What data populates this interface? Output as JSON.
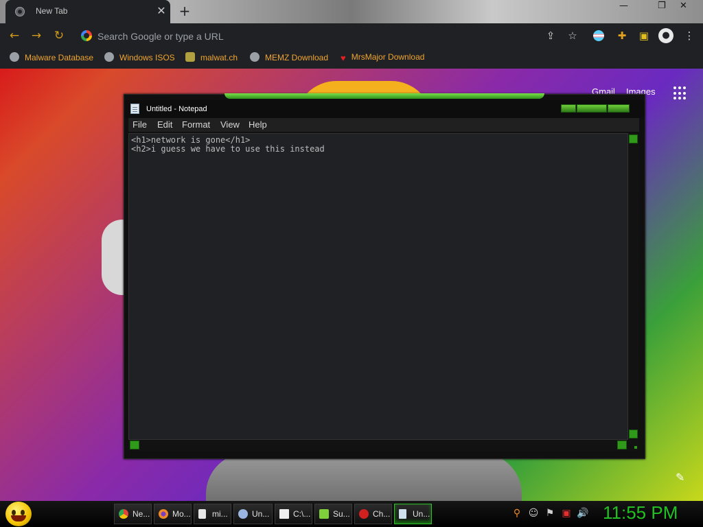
{
  "browser": {
    "tab_title": "New Tab",
    "tab_close": "✕",
    "new_tab": "+",
    "window_controls": {
      "minimize": "—",
      "restore": "❐",
      "close": "✕"
    },
    "omnibox_placeholder": "Search Google or type a URL",
    "bookmarks": [
      {
        "label": "Malware Database",
        "icon": "globe-icon"
      },
      {
        "label": "Windows ISOS",
        "icon": "globe-icon"
      },
      {
        "label": "malwat.ch",
        "icon": "person-icon"
      },
      {
        "label": "MEMZ Download",
        "icon": "globe-icon"
      },
      {
        "label": "MrsMajor Download",
        "icon": "heart-icon"
      }
    ]
  },
  "newtab_page": {
    "links": [
      "Gmail",
      "Images"
    ]
  },
  "notepad": {
    "title": "Untitled - Notepad",
    "menu": [
      "File",
      "Edit",
      "Format",
      "View",
      "Help"
    ],
    "content_lines": [
      "<h1>network is gone</h1>",
      "<h2>i guess we have to use this instead"
    ]
  },
  "taskbar": {
    "items": [
      {
        "label": "Ne...",
        "icon": "chrome-icon",
        "color": "#e0443a"
      },
      {
        "label": "Mo...",
        "icon": "firefox-icon",
        "color": "#f08a24"
      },
      {
        "label": "mi...",
        "icon": "document-icon",
        "color": "#e8e8e8"
      },
      {
        "label": "Un...",
        "icon": "paint-icon",
        "color": "#9ab6e0"
      },
      {
        "label": "C:\\...",
        "icon": "7zip-icon",
        "color": "#f0f0f0"
      },
      {
        "label": "Su...",
        "icon": "sumatra-icon",
        "color": "#7fcf3a"
      },
      {
        "label": "Ch...",
        "icon": "app-icon",
        "color": "#d02020"
      },
      {
        "label": "Un...",
        "icon": "notepad-icon",
        "color": "#cfe0ef",
        "active": true
      }
    ],
    "clock": "11:55 PM"
  },
  "colors": {
    "accent_green": "#22c022",
    "bookmark_text": "#f0a530",
    "chrome_dark": "#202124"
  }
}
